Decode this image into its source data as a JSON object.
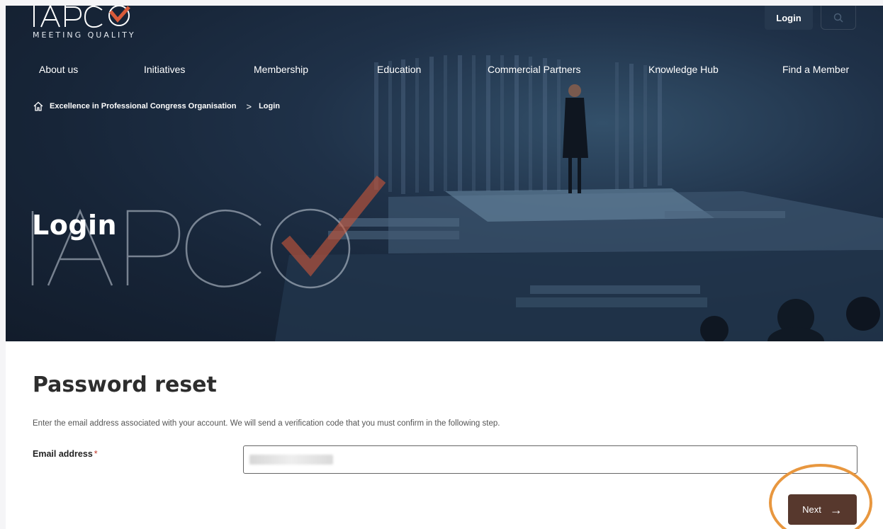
{
  "header": {
    "logo_tagline": "MEETING QUALITY",
    "login_label": "Login"
  },
  "nav": {
    "items": [
      {
        "label": "About us"
      },
      {
        "label": "Initiatives"
      },
      {
        "label": "Membership"
      },
      {
        "label": "Education"
      },
      {
        "label": "Commercial Partners"
      },
      {
        "label": "Knowledge Hub"
      },
      {
        "label": "Find a Member"
      }
    ]
  },
  "breadcrumb": {
    "home_label": "Excellence in Professional Congress Organisation",
    "separator": ">",
    "current": "Login"
  },
  "hero": {
    "title": "Login",
    "watermark": "IAPCO"
  },
  "form": {
    "title": "Password reset",
    "intro": "Enter the email address associated with your account. We will send a verification code that you must confirm in the following step.",
    "email_label": "Email address",
    "required_marker": "*",
    "next_label": "Next",
    "next_arrow": "→"
  },
  "colors": {
    "hero_bg": "#1a2a3e",
    "accent": "#e8973f",
    "button": "#57382d",
    "logo_check": "#d95b3a"
  }
}
